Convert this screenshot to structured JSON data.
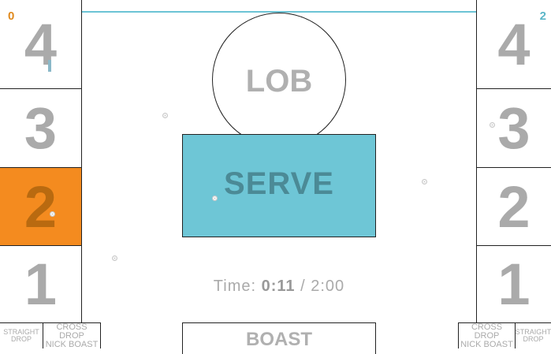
{
  "scores": {
    "left": "0",
    "right": "2"
  },
  "zones": {
    "left": [
      "4",
      "3",
      "2",
      "1"
    ],
    "right": [
      "4",
      "3",
      "2",
      "1"
    ],
    "active_left_index": 2,
    "active_color": "#f48b1f"
  },
  "shots": {
    "left_straight": [
      "STRAIGHT",
      "DROP"
    ],
    "left_cross": [
      "CROSS DROP",
      "NICK BOAST"
    ],
    "right_cross": [
      "CROSS DROP",
      "NICK BOAST"
    ],
    "right_straight": [
      "STRAIGHT",
      "DROP"
    ]
  },
  "center": {
    "lob": "LOB",
    "serve": "SERVE",
    "boast": "BOAST",
    "serve_color": "#6ec6d6"
  },
  "timer": {
    "label": "Time:",
    "elapsed": "0:11",
    "separator": "/",
    "total": "2:00"
  }
}
